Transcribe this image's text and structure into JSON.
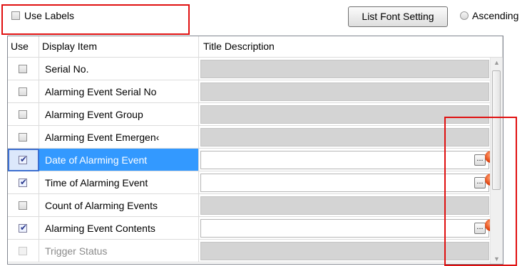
{
  "top": {
    "use_labels": "Use Labels",
    "list_font_setting": "List Font Setting",
    "ascending": "Ascending"
  },
  "grid": {
    "headers": [
      "Use",
      "Display Item",
      "Title Description"
    ],
    "rows": [
      {
        "checked": false,
        "item": "Serial No.",
        "editable": false
      },
      {
        "checked": false,
        "item": "Alarming Event Serial No",
        "editable": false
      },
      {
        "checked": false,
        "item": "Alarming Event Group",
        "editable": false
      },
      {
        "checked": false,
        "item": "Alarming Event Emergen‹",
        "editable": false
      },
      {
        "checked": true,
        "item": "Date of Alarming Event",
        "editable": true,
        "selected": true
      },
      {
        "checked": true,
        "item": "Time of Alarming Event",
        "editable": true
      },
      {
        "checked": false,
        "item": "Count of Alarming Events",
        "editable": false
      },
      {
        "checked": true,
        "item": "Alarming Event Contents",
        "editable": true
      },
      {
        "checked": false,
        "item": "Trigger Status",
        "editable": false,
        "disabled": true
      }
    ],
    "ellipsis_label": "...",
    "error_label": "!"
  },
  "colors": {
    "highlight": "#3399ff",
    "annotation": "#e01010"
  }
}
